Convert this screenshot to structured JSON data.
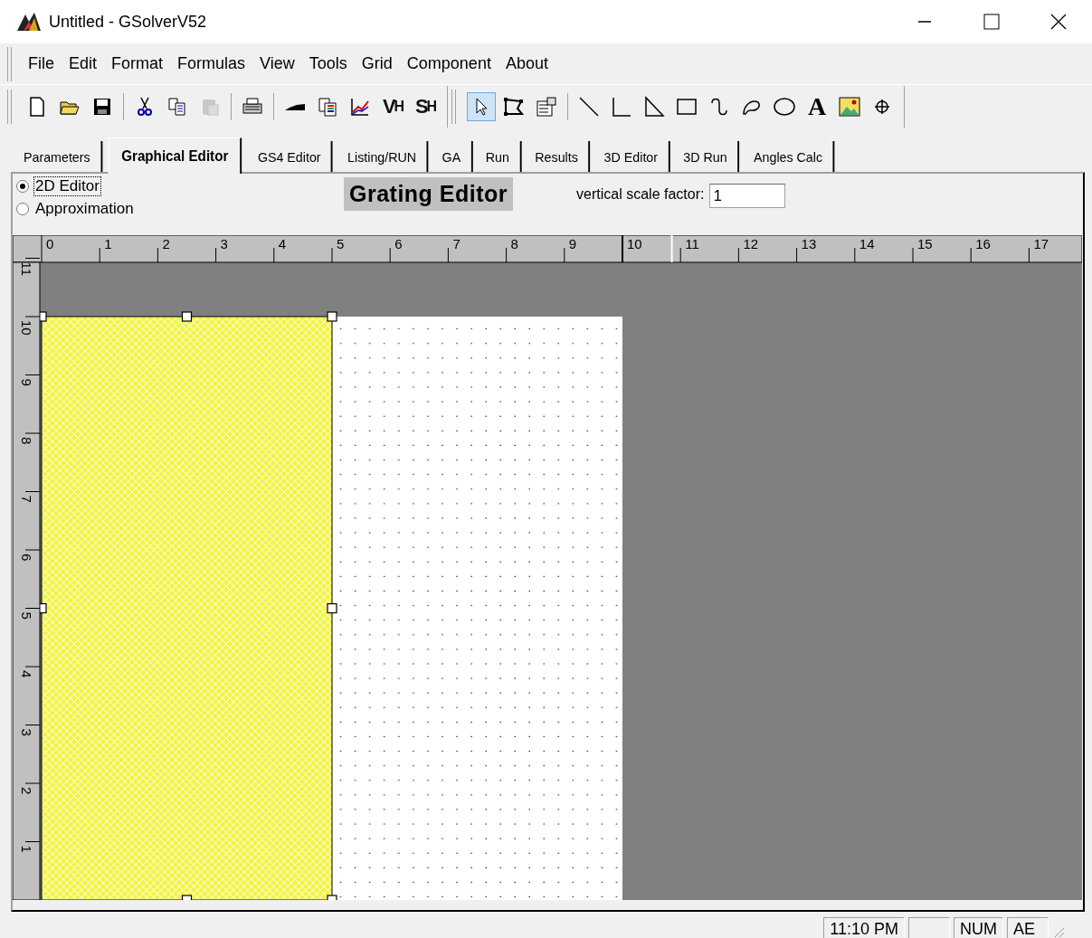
{
  "window": {
    "title": "Untitled - GSolverV52"
  },
  "menu": [
    {
      "label": "File"
    },
    {
      "label": "Edit"
    },
    {
      "label": "Format"
    },
    {
      "label": "Formulas"
    },
    {
      "label": "View"
    },
    {
      "label": "Tools"
    },
    {
      "label": "Grid"
    },
    {
      "label": "Component"
    },
    {
      "label": "About"
    }
  ],
  "toolbars": [
    {
      "groups": [
        [
          {
            "kind": "new",
            "pressed": false,
            "disabled": false
          },
          {
            "kind": "open",
            "pressed": false,
            "disabled": false
          },
          {
            "kind": "save",
            "pressed": false,
            "disabled": false
          }
        ],
        [
          {
            "kind": "cut",
            "pressed": false,
            "disabled": false
          },
          {
            "kind": "copy",
            "pressed": false,
            "disabled": false
          },
          {
            "kind": "paste",
            "pressed": false,
            "disabled": true
          }
        ],
        [
          {
            "kind": "print",
            "pressed": false,
            "disabled": false
          }
        ],
        [
          {
            "kind": "profile",
            "pressed": false,
            "disabled": false
          },
          {
            "kind": "layers",
            "pressed": false,
            "disabled": false
          },
          {
            "kind": "graph",
            "pressed": false,
            "disabled": false
          },
          {
            "kind": "glyph",
            "label": "V",
            "sub": "H",
            "pressed": false,
            "disabled": false
          },
          {
            "kind": "glyph",
            "label": "S",
            "sub": "H",
            "pressed": false,
            "disabled": false
          }
        ]
      ]
    },
    {
      "groups": [
        [
          {
            "kind": "pointer",
            "pressed": true,
            "disabled": false
          },
          {
            "kind": "node-edit",
            "pressed": false,
            "disabled": false
          },
          {
            "kind": "properties",
            "pressed": false,
            "disabled": false
          }
        ],
        [
          {
            "kind": "line",
            "pressed": false,
            "disabled": false
          },
          {
            "kind": "angle",
            "pressed": false,
            "disabled": false
          },
          {
            "kind": "triangle",
            "pressed": false,
            "disabled": false
          },
          {
            "kind": "rectangle",
            "pressed": false,
            "disabled": false
          },
          {
            "kind": "curve",
            "pressed": false,
            "disabled": false
          },
          {
            "kind": "freeform",
            "pressed": false,
            "disabled": false
          },
          {
            "kind": "ellipse",
            "pressed": false,
            "disabled": false
          },
          {
            "kind": "text",
            "label": "A",
            "pressed": false,
            "disabled": false
          },
          {
            "kind": "image",
            "pressed": false,
            "disabled": false
          },
          {
            "kind": "crosshair",
            "pressed": false,
            "disabled": false
          }
        ]
      ]
    }
  ],
  "tabs": [
    {
      "label": "Parameters",
      "selected": false
    },
    {
      "label": "Graphical Editor",
      "selected": true
    },
    {
      "label": "GS4 Editor",
      "selected": false
    },
    {
      "label": "Listing/RUN",
      "selected": false
    },
    {
      "label": "GA",
      "selected": false
    },
    {
      "label": "Run",
      "selected": false
    },
    {
      "label": "Results",
      "selected": false
    },
    {
      "label": "3D Editor",
      "selected": false
    },
    {
      "label": "3D Run",
      "selected": false
    },
    {
      "label": "Angles Calc",
      "selected": false
    }
  ],
  "mode_options": [
    {
      "label": "2D Editor",
      "selected": true,
      "focused": true
    },
    {
      "label": "Approximation",
      "selected": false,
      "focused": false
    }
  ],
  "editor_title": "Grating Editor",
  "scale_field": {
    "label": "vertical scale factor:",
    "value": "1"
  },
  "ruler": {
    "x_labels": [
      "0",
      "1",
      "2",
      "3",
      "4",
      "5",
      "6",
      "7",
      "8",
      "9",
      "10",
      "11",
      "12",
      "13",
      "14",
      "15",
      "16",
      "17"
    ],
    "y_labels": [
      "11",
      "10",
      "9",
      "8",
      "7",
      "6",
      "5",
      "4",
      "3",
      "2",
      "1"
    ]
  },
  "canvas": {
    "shapes": [
      {
        "kind": "hatched-rectangle",
        "selected": true
      }
    ]
  },
  "status_bar": {
    "panes": [
      {
        "kind": "text",
        "text": "11:10 PM"
      },
      {
        "kind": "blank"
      },
      {
        "kind": "text",
        "text": "NUM"
      },
      {
        "kind": "text",
        "text": "AE"
      }
    ]
  }
}
